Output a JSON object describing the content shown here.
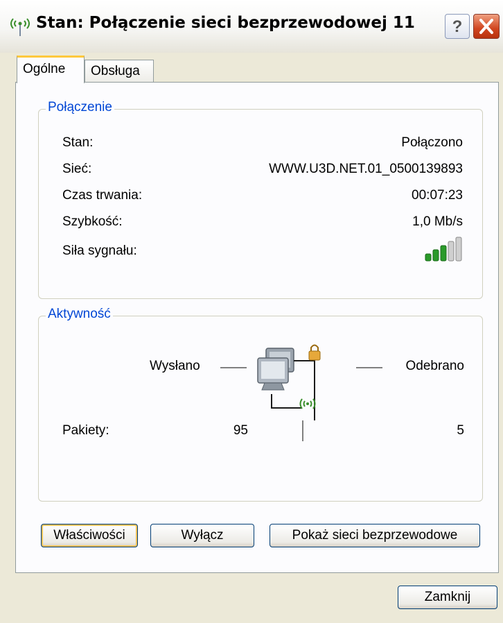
{
  "window": {
    "title": "Stan: Połączenie sieci bezprzewodowej 11",
    "help_label": "?"
  },
  "tabs": [
    {
      "label": "Ogólne",
      "active": true
    },
    {
      "label": "Obsługa",
      "active": false
    }
  ],
  "connection": {
    "title": "Połączenie",
    "rows": [
      {
        "label": "Stan:",
        "value": "Połączono"
      },
      {
        "label": "Sieć:",
        "value": "WWW.U3D.NET.01_0500139893"
      },
      {
        "label": "Czas trwania:",
        "value": "00:07:23"
      },
      {
        "label": "Szybkość:",
        "value": "1,0 Mb/s"
      },
      {
        "label": "Siła sygnału:",
        "value_icon": "signal-strength-icon"
      }
    ],
    "signal_bars_active": 3,
    "signal_bars_total": 5
  },
  "activity": {
    "title": "Aktywność",
    "sent_label": "Wysłano",
    "received_label": "Odebrano",
    "packets_label": "Pakiety:",
    "packets_sent": "95",
    "packets_received": "5"
  },
  "buttons": {
    "properties": "Właściwości",
    "disable": "Wyłącz",
    "show_networks": "Pokaż sieci bezprzewodowe",
    "close": "Zamknij"
  },
  "colors": {
    "group_title": "#0046d5",
    "signal_active": "#2a9a2a",
    "signal_inactive": "#cfcfcf",
    "close_button": "#d0451f"
  }
}
